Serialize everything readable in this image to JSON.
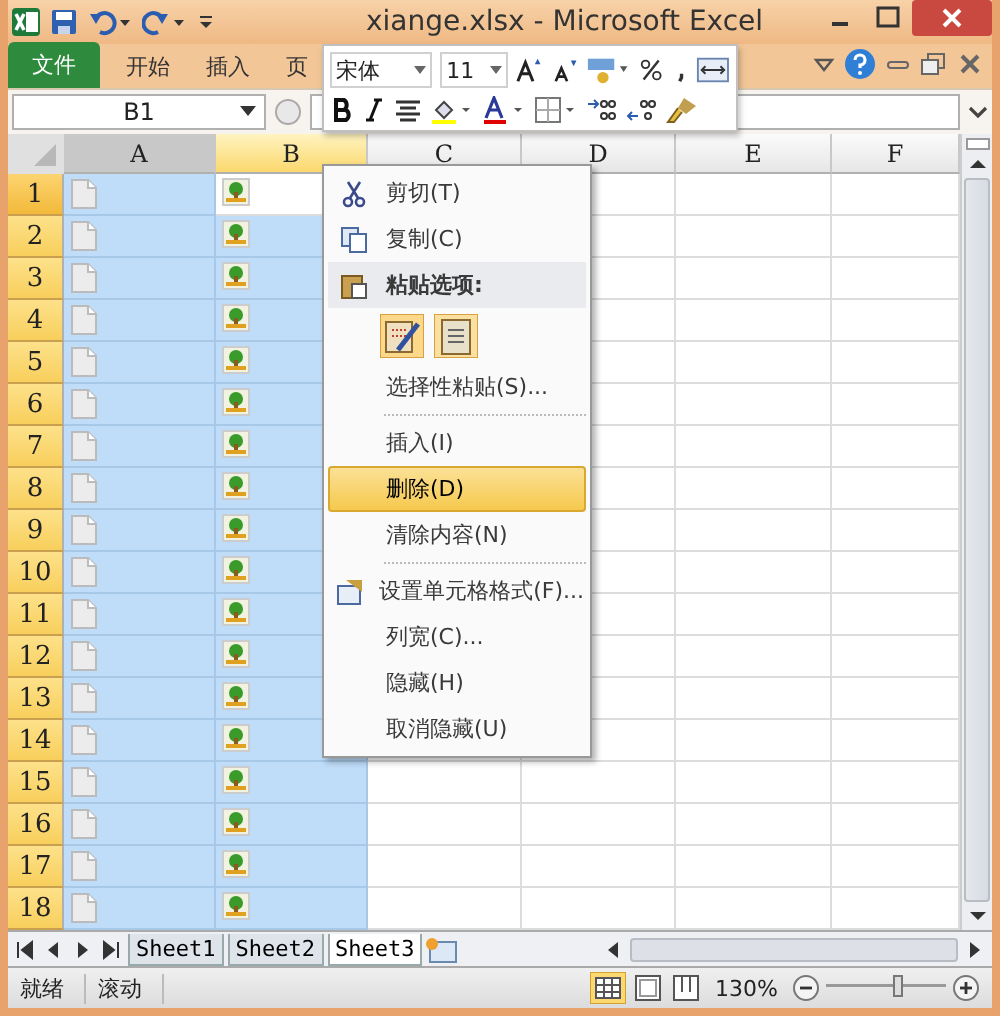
{
  "window": {
    "title": "xiange.xlsx - Microsoft Excel"
  },
  "ribbon_tabs": [
    {
      "label": "文件",
      "kind": "file"
    },
    {
      "label": "开始",
      "kind": "tab"
    },
    {
      "label": "插入",
      "kind": "tab"
    },
    {
      "label": "页",
      "kind": "tab"
    }
  ],
  "name_box": {
    "value": "B1"
  },
  "mini_toolbar": {
    "font": "宋体",
    "size": "11"
  },
  "columns": [
    {
      "label": "A",
      "selected": true,
      "active": false
    },
    {
      "label": "B",
      "selected": true,
      "active": true
    },
    {
      "label": "C",
      "selected": false,
      "active": false
    },
    {
      "label": "D",
      "selected": false,
      "active": false
    },
    {
      "label": "E",
      "selected": false,
      "active": false
    },
    {
      "label": "F",
      "selected": false,
      "active": false
    }
  ],
  "rows": [
    {
      "label": "1",
      "active": true
    },
    {
      "label": "2",
      "active": false
    },
    {
      "label": "3",
      "active": false
    },
    {
      "label": "4",
      "active": false
    },
    {
      "label": "5",
      "active": false
    },
    {
      "label": "6",
      "active": false
    },
    {
      "label": "7",
      "active": false
    },
    {
      "label": "8",
      "active": false
    },
    {
      "label": "9",
      "active": false
    },
    {
      "label": "10",
      "active": false
    },
    {
      "label": "11",
      "active": false
    },
    {
      "label": "12",
      "active": false
    },
    {
      "label": "13",
      "active": false
    },
    {
      "label": "14",
      "active": false
    },
    {
      "label": "15",
      "active": false
    },
    {
      "label": "16",
      "active": false
    },
    {
      "label": "17",
      "active": false
    },
    {
      "label": "18",
      "active": false
    }
  ],
  "context_menu": [
    {
      "kind": "cut",
      "label": "剪切(T)",
      "selected": false
    },
    {
      "kind": "copy",
      "label": "复制(C)",
      "selected": false
    },
    {
      "kind": "paste-header",
      "label": "粘贴选项:",
      "selected": false
    },
    {
      "kind": "paste-options"
    },
    {
      "kind": "item",
      "label": "选择性粘贴(S)...",
      "selected": false
    },
    {
      "kind": "separator"
    },
    {
      "kind": "item",
      "label": "插入(I)",
      "selected": false
    },
    {
      "kind": "item",
      "label": "删除(D)",
      "selected": true
    },
    {
      "kind": "item",
      "label": "清除内容(N)",
      "selected": false
    },
    {
      "kind": "separator"
    },
    {
      "kind": "format",
      "label": "设置单元格格式(F)...",
      "selected": false
    },
    {
      "kind": "item",
      "label": "列宽(C)...",
      "selected": false
    },
    {
      "kind": "item",
      "label": "隐藏(H)",
      "selected": false
    },
    {
      "kind": "item",
      "label": "取消隐藏(U)",
      "selected": false
    }
  ],
  "sheet_tabs": [
    {
      "label": "Sheet1",
      "selected": false
    },
    {
      "label": "Sheet2",
      "selected": false
    },
    {
      "label": "Sheet3",
      "selected": true
    }
  ],
  "status_bar": {
    "items": [
      "就绪",
      "滚动"
    ],
    "zoom": "130%"
  }
}
